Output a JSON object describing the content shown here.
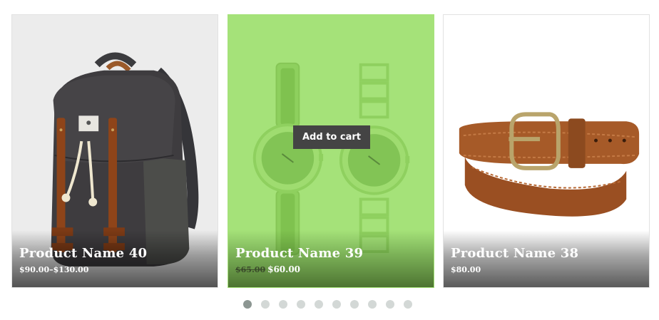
{
  "products": [
    {
      "name": "Product Name 40",
      "price": "$90.00–$130.00",
      "image_icon": "backpack-icon"
    },
    {
      "name": "Product Name 39",
      "old_price": "$65.00",
      "price": "$60.00",
      "image_icon": "watches-icon",
      "hover_button": "Add to cart"
    },
    {
      "name": "Product Name 38",
      "price": "$80.00",
      "image_icon": "belt-icon"
    }
  ],
  "pagination": {
    "count": 10,
    "active_index": 0
  },
  "colors": {
    "hover_overlay": "#a5e279",
    "button_bg": "#444444",
    "dot": "#d3d8d6",
    "dot_active": "#8c9692"
  }
}
